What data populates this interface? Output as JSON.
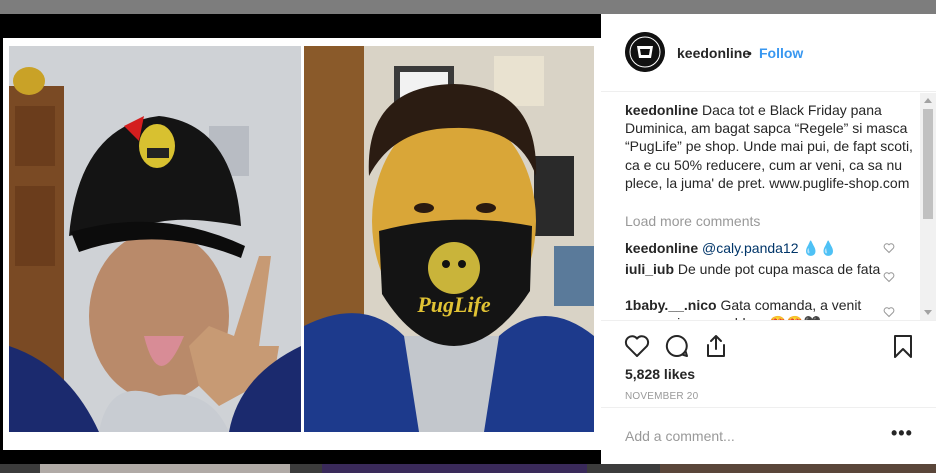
{
  "post": {
    "username": "keedonline",
    "separator": "•",
    "follow_label": "Follow",
    "caption_text": "Daca tot e Black Friday pana Duminica, am bagat sapca “Regele” si masca “PugLife” pe shop. Unde mai pui, de fapt scoti, ca e cu 50% reducere, cum ar veni, ca sa nu plece, la juma' de pret. www.puglife-shop.com",
    "load_more_label": "Load more comments",
    "likes": "5,828 likes",
    "date": "NOVEMBER 20",
    "add_comment_placeholder": "Add a comment...",
    "more_options": "•••",
    "mask_text": "PugLife"
  },
  "comments": [
    {
      "user": "keedonline",
      "mention": "@caly.panda12",
      "text": " 💧💧"
    },
    {
      "user": "iuli_iub",
      "text": "De unde pot cupa masca de fata"
    },
    {
      "user": "1baby.__.nico",
      "text": "Gata comanda, a venit masca si e super blana😍😍🖤"
    }
  ],
  "icons": [
    "avatar",
    "heart-icon",
    "comment-icon",
    "share-icon",
    "bookmark-icon"
  ],
  "colors": {
    "follow": "#3897f0",
    "muted": "#999999",
    "mention": "#003569"
  }
}
